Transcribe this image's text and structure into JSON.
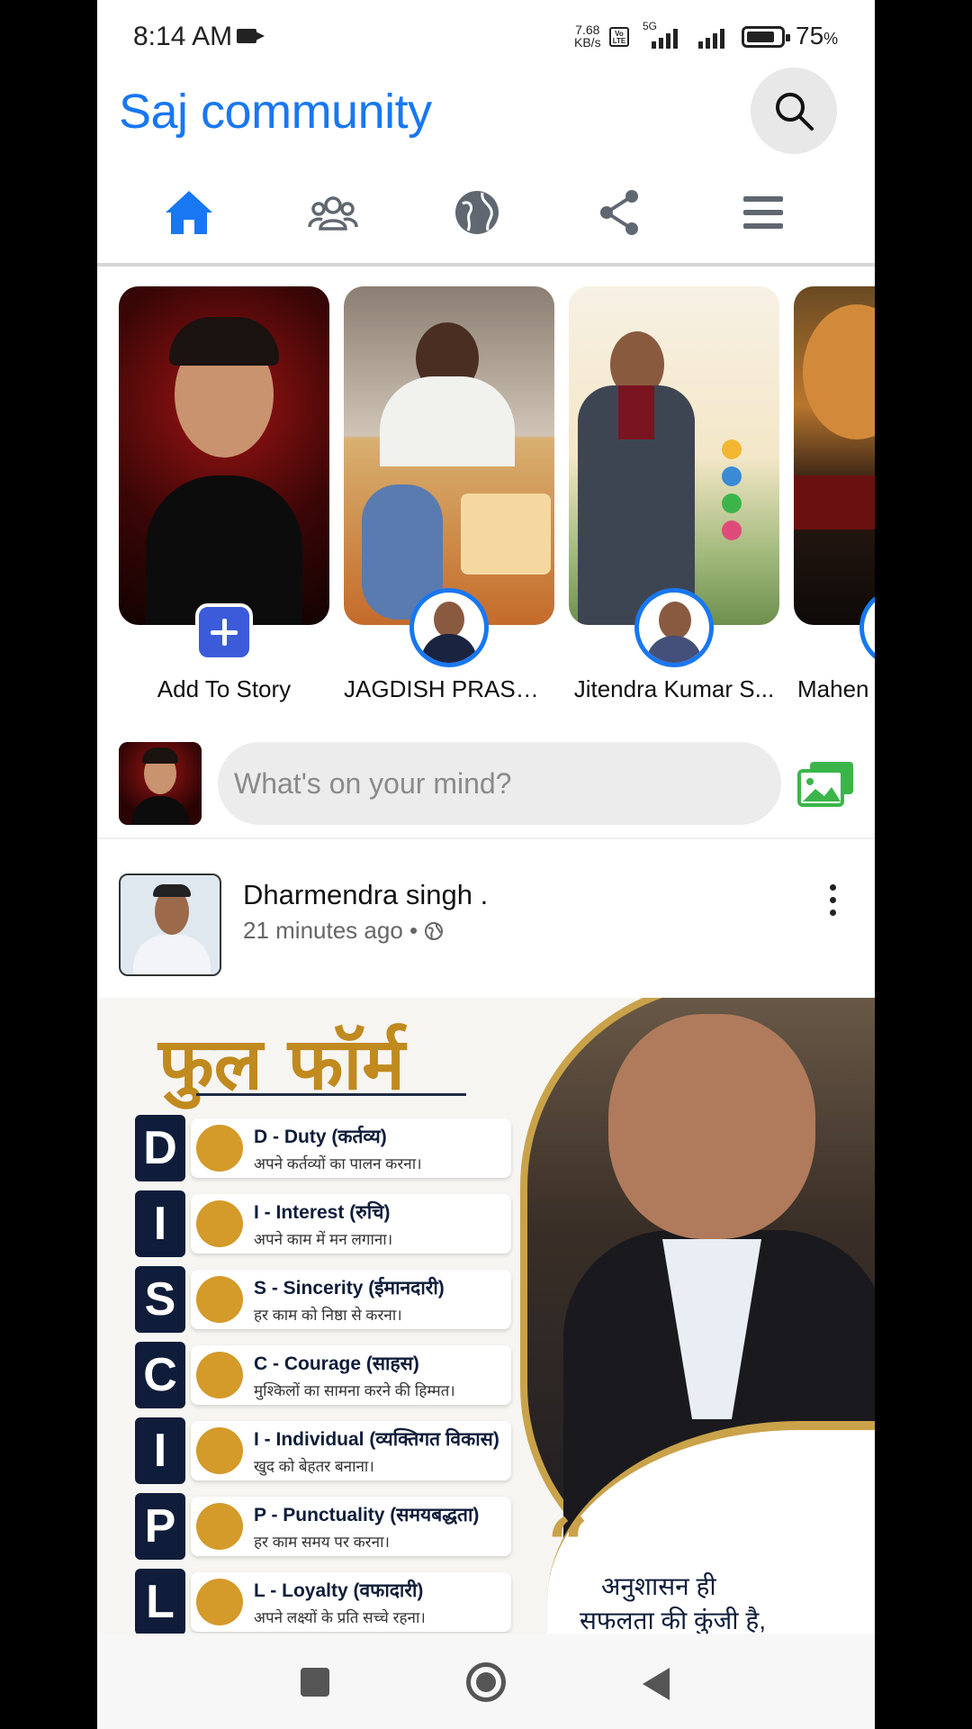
{
  "status_bar": {
    "time": "8:14 AM",
    "net_speed_value": "7.68",
    "net_speed_unit": "KB/s",
    "volte": "Vo LTE",
    "network_type": "5G",
    "battery_percent": "75",
    "battery_unit": "%"
  },
  "header": {
    "title": "Saj community",
    "search_icon": "search-icon"
  },
  "nav": {
    "tabs": [
      {
        "icon": "home-icon",
        "active": true
      },
      {
        "icon": "groups-icon",
        "active": false
      },
      {
        "icon": "globe-icon",
        "active": false
      },
      {
        "icon": "share-icon",
        "active": false
      },
      {
        "icon": "menu-icon",
        "active": false
      }
    ],
    "active_color": "#1877f2",
    "inactive_color": "#606770"
  },
  "stories": [
    {
      "label": "Add To Story",
      "type": "add"
    },
    {
      "label": "JAGDISH PRASAD ..."
    },
    {
      "label": "Jitendra Kumar S..."
    },
    {
      "label": "Mahen"
    }
  ],
  "composer": {
    "placeholder": "What's on your mind?",
    "photo_icon": "photo-gallery-icon"
  },
  "post": {
    "author": "Dharmendra singh .",
    "time": "21 minutes ago",
    "separator": "•",
    "privacy_icon": "globe-icon",
    "image": {
      "title": "फुल फॉर्म",
      "rows": [
        {
          "letter": "D",
          "title": "D - Duty (कर्तव्य)",
          "desc": "अपने कर्तव्यों का पालन करना।"
        },
        {
          "letter": "I",
          "title": "I - Interest (रुचि)",
          "desc": "अपने काम में मन लगाना।"
        },
        {
          "letter": "S",
          "title": "S - Sincerity (ईमानदारी)",
          "desc": "हर काम को निष्ठा से करना।"
        },
        {
          "letter": "C",
          "title": "C - Courage (साहस)",
          "desc": "मुश्किलों का सामना करने की हिम्मत।"
        },
        {
          "letter": "I",
          "title": "I - Individual (व्यक्तिगत विकास)",
          "desc": "खुद को बेहतर बनाना।"
        },
        {
          "letter": "P",
          "title": "P - Punctuality (समयबद्धता)",
          "desc": "हर काम समय पर करना।"
        },
        {
          "letter": "L",
          "title": "L - Loyalty (वफादारी)",
          "desc": "अपने लक्ष्यों के प्रति सच्चे रहना।"
        }
      ],
      "quote_line1": "अनुशासन ही",
      "quote_line2": "सफलता की कुंजी है,"
    }
  }
}
